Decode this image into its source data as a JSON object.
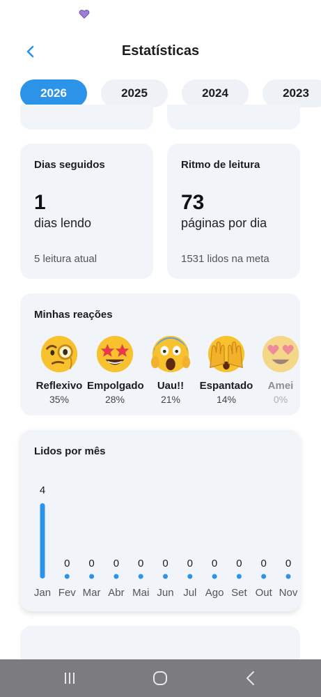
{
  "header": {
    "title": "Estatísticas"
  },
  "years": [
    "2026",
    "2025",
    "2024",
    "2023"
  ],
  "active_year": "2026",
  "streak": {
    "title": "Dias seguidos",
    "value": "1",
    "subtitle": "dias lendo",
    "footer": "5 leitura atual"
  },
  "pace": {
    "title": "Ritmo de leitura",
    "value": "73",
    "subtitle": "páginas por dia",
    "footer": "1531 lidos na meta"
  },
  "reactions": {
    "title": "Minhas reações",
    "items": [
      {
        "label": "Reflexivo",
        "percent": "35%",
        "icon": "monocle-face-emoji"
      },
      {
        "label": "Empolgado",
        "percent": "28%",
        "icon": "star-struck-emoji"
      },
      {
        "label": "Uau!!",
        "percent": "21%",
        "icon": "screaming-face-emoji"
      },
      {
        "label": "Espantado",
        "percent": "14%",
        "icon": "face-with-hands-emoji"
      },
      {
        "label": "Amei",
        "percent": "0%",
        "icon": "heart-eyes-emoji"
      }
    ]
  },
  "monthly": {
    "title": "Lidos por mês"
  },
  "colors": {
    "accent": "#2b93e8",
    "card": "#f1f4f8",
    "nav_bar": "#7c7c7e"
  },
  "chart_data": {
    "type": "bar",
    "title": "Lidos por mês",
    "categories": [
      "Jan",
      "Fev",
      "Mar",
      "Abr",
      "Mai",
      "Jun",
      "Jul",
      "Ago",
      "Set",
      "Out",
      "Nov"
    ],
    "values": [
      4,
      0,
      0,
      0,
      0,
      0,
      0,
      0,
      0,
      0,
      0
    ],
    "ylim": [
      0,
      4
    ],
    "grid": false,
    "legend": "none"
  }
}
